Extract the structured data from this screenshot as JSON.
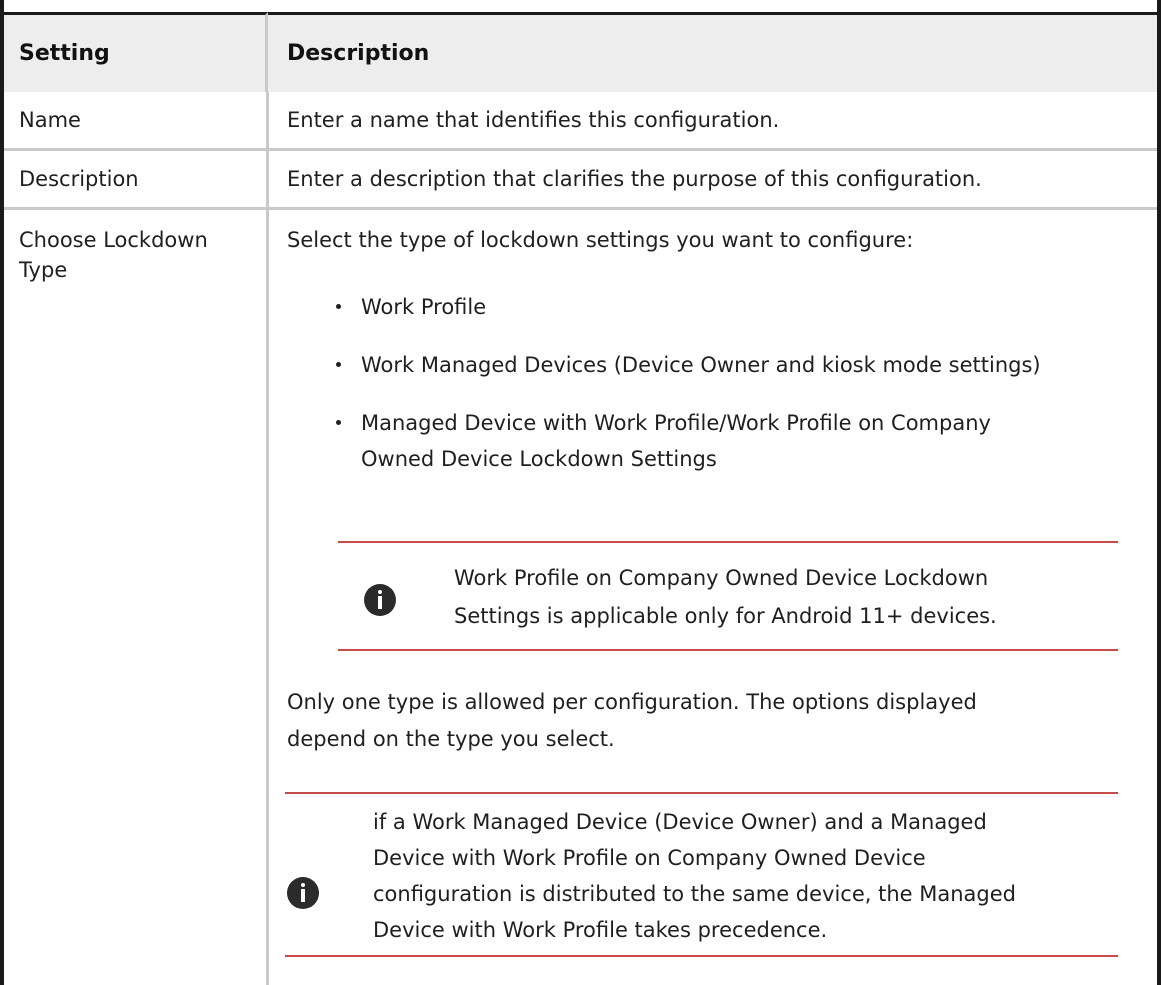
{
  "table": {
    "headers": {
      "setting": "Setting",
      "description": "Description"
    },
    "rows": [
      {
        "setting": "Name",
        "description": "Enter a name that identifies this configuration."
      },
      {
        "setting": "Description",
        "description": "Enter a description that clarifies the purpose of this configuration."
      },
      {
        "setting_lines": [
          "Choose Lockdown",
          "Type"
        ],
        "intro": "Select the type of lockdown settings you want to configure:",
        "options": [
          "Work Profile",
          "Work Managed Devices (Device Owner and kiosk mode settings)",
          "Managed Device with Work Profile/Work Profile on Company"
        ],
        "option3_line2": "Owned Device Lockdown Settings",
        "note1_lines": [
          "Work Profile on Company Owned Device Lockdown",
          "Settings is applicable only for Android 11+ devices."
        ],
        "para_lines": [
          "Only one type is allowed per configuration. The options displayed",
          "depend on the type you select."
        ],
        "note2_lines": [
          "if a Work Managed Device (Device Owner) and a Managed",
          "Device with Work Profile on Company Owned Device",
          "configuration is distributed to the same device, the Managed",
          "Device with Work Profile takes precedence."
        ]
      }
    ]
  },
  "icons": {
    "note": "info-icon"
  }
}
